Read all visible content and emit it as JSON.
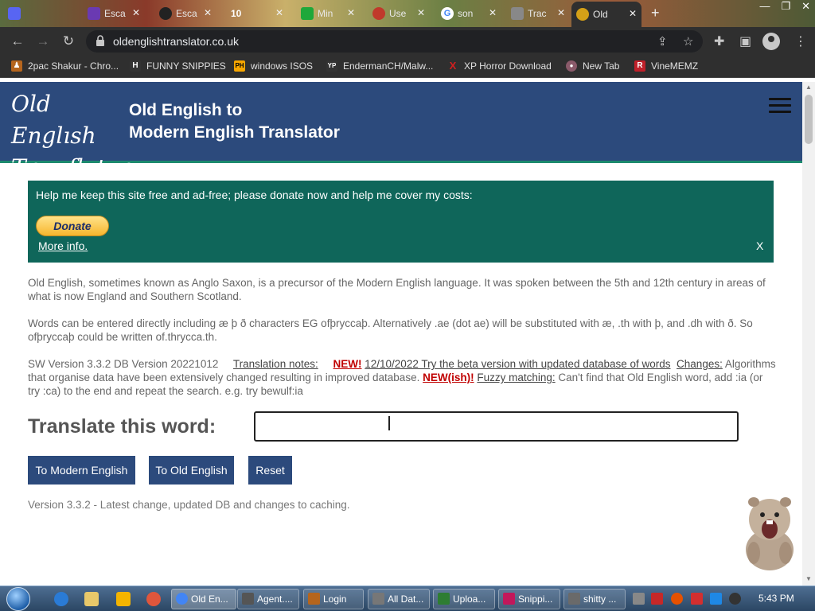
{
  "browser": {
    "tabs": [
      {
        "label": "",
        "color": "#5865f2"
      },
      {
        "label": "Esca",
        "color": "#6a3ab2"
      },
      {
        "label": "Esca",
        "color": "#222222"
      },
      {
        "label": "10 ",
        "color": "#333333"
      },
      {
        "label": "Min",
        "color": "#1fa83a"
      },
      {
        "label": "Use",
        "color": "#c0392b"
      },
      {
        "label": "son",
        "color": "#4285f4"
      },
      {
        "label": "Trac",
        "color": "#888888"
      },
      {
        "label": "Old",
        "color": "#d4a017"
      }
    ],
    "new_tab": "+",
    "window_controls": {
      "minimize": "—",
      "restore": "❐",
      "close": "✕"
    },
    "url": "oldenglishtranslator.co.uk",
    "bookmarks": [
      {
        "label": "2pac Shakur - Chro...",
        "color": "#b5651d",
        "glyph": "♟"
      },
      {
        "label": "FUNNY SNIPPIES",
        "color": "#333333",
        "glyph": "H"
      },
      {
        "label": "windows ISOS",
        "color": "#f7a600",
        "glyph": "PH"
      },
      {
        "label": "EndermanCH/Malw...",
        "color": "#333333",
        "glyph": "YP"
      },
      {
        "label": "XP Horror Download",
        "color": "#d21f1f",
        "glyph": "X"
      },
      {
        "label": "New Tab",
        "color": "#8a5a6a",
        "glyph": "●"
      },
      {
        "label": "VineMEMZ",
        "color": "#c0202a",
        "glyph": "R"
      }
    ]
  },
  "site": {
    "logo_line1": "Old Englısh",
    "logo_line2": "Tɲanſlatoɲ",
    "title_line1": "Old English to",
    "title_line2": "Modern English Translator"
  },
  "donate": {
    "text": "Help me keep this site free and ad-free; please donate now and help me cover my costs:",
    "button": "Donate",
    "more_info": "More info.",
    "close": "X"
  },
  "intro": {
    "p1": "Old English, sometimes known as Anglo Saxon, is a precursor of the Modern English language. It was spoken between the 5th and 12th century in areas of what is now England and Southern Scotland.",
    "p2": "Words can be entered directly including æ þ ð characters EG ofþryccaþ. Alternatively .ae (dot ae) will be substituted with æ, .th with þ, and .dh with ð. So ofþryccaþ could be written of.thrycca.th.",
    "p3_version": "SW Version 3.3.2 DB Version 20221012",
    "p3_notes_link": "Translation notes:",
    "p3_new": "NEW!",
    "p3_beta_link": "12/10/2022 Try the beta version with updated database of words",
    "p3_changes_link": "Changes:",
    "p3_changes_text": "Algorithms that organise data have been extensively changed resulting in improved database.",
    "p3_newish": "NEW(ish)!",
    "p3_fuzzy_link": "Fuzzy matching:",
    "p3_fuzzy_text": "Can't find that Old English word, add :ia (or try :ca) to the end and repeat the search. e.g. try bewulf:ia"
  },
  "translate": {
    "label": "Translate this word:",
    "input_value": "",
    "btn_modern": "To Modern English",
    "btn_old": "To Old English",
    "btn_reset": "Reset",
    "version_note": "Version 3.3.2 - Latest change, updated DB and changes to caching."
  },
  "taskbar": {
    "windows": [
      {
        "label": "Old En...",
        "color": "#4285f4"
      },
      {
        "label": "Agent....",
        "color": "#555555"
      },
      {
        "label": "Login",
        "color": "#b5651d"
      },
      {
        "label": "All Dat...",
        "color": "#777777"
      },
      {
        "label": "Uploa...",
        "color": "#2e7d32"
      },
      {
        "label": "Snippi...",
        "color": "#c2185b"
      },
      {
        "label": "shitty ...",
        "color": "#6a6a6a"
      }
    ],
    "clock": "5:43 PM"
  }
}
